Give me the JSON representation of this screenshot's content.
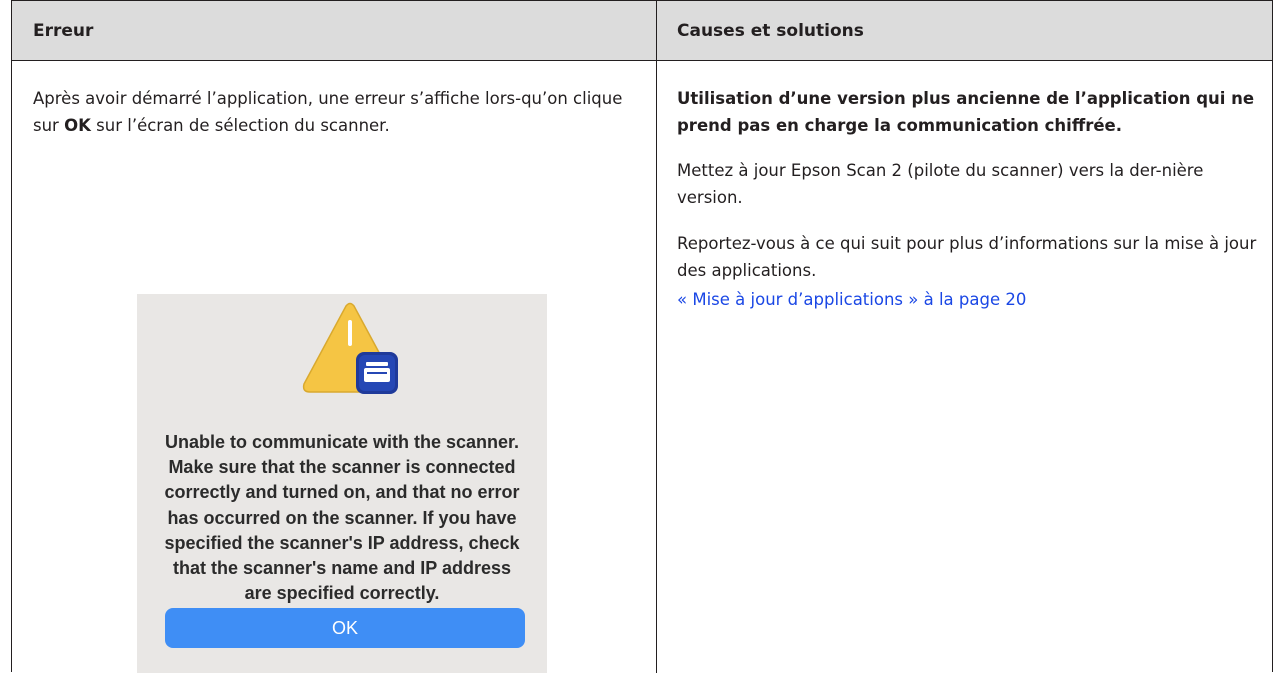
{
  "table": {
    "headers": [
      "Erreur",
      "Causes et solutions"
    ],
    "error": {
      "text_before": "Après avoir démarré l’application, une erreur s’affiche lors-qu’on clique sur ",
      "bold": "OK",
      "text_after": " sur l’écran de sélection du scanner."
    },
    "dialog": {
      "icon": "warning-scanner-icon",
      "message": "Unable to communicate with the scanner. Make sure that the scanner is connected correctly and turned on, and that no error has occurred on the scanner. If you have specified the scanner's IP address, check that the scanner's name and IP address are specified correctly.",
      "ok_label": "OK"
    },
    "causes": {
      "title": "Utilisation d’une version plus ancienne de l’application qui ne prend pas en charge la communication chiffrée.",
      "p1": "Mettez à jour Epson Scan 2 (pilote du scanner) vers la der-nière version.",
      "p2": "Reportez-vous à ce qui suit pour plus d’informations sur la mise à jour des applications.",
      "link": "« Mise à jour d’applications » à la page 20"
    }
  },
  "colors": {
    "header_bg": "#dcdcdc",
    "link": "#1a47e5",
    "dialog_bg": "#e9e7e5",
    "ok_button": "#3f8ef5",
    "warning_yellow": "#f5c544",
    "scanner_badge": "#1f3a9a"
  }
}
